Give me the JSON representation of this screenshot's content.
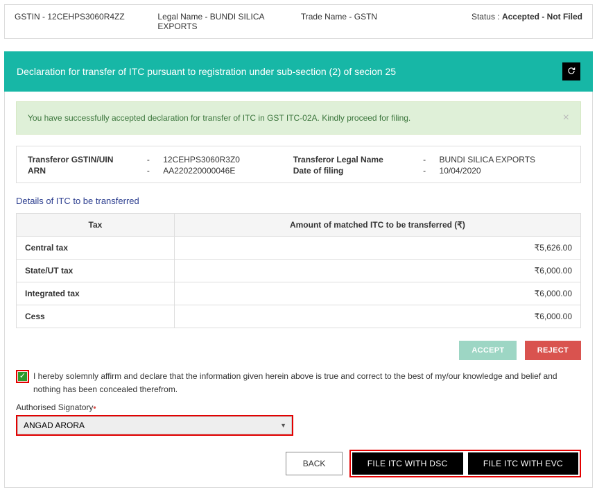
{
  "infoBar": {
    "gstin_label": "GSTIN - ",
    "gstin": "12CEHPS3060R4ZZ",
    "legalName_label": "Legal Name - ",
    "legalName": "BUNDI SILICA EXPORTS",
    "tradeName_label": "Trade Name - ",
    "tradeName": "GSTN",
    "status_label": "Status : ",
    "status_value": "Accepted - Not Filed"
  },
  "header": {
    "title": "Declaration for transfer of ITC pursuant to registration under sub-section (2) of secion 25"
  },
  "alert": {
    "message": "You have successfully accepted declaration for transfer of ITC in GST ITC-02A. Kindly proceed for filing."
  },
  "transferor": {
    "gstinLabel": "Transferor GSTIN/UIN",
    "gstinValue": "12CEHPS3060R3Z0",
    "arnLabel": "ARN",
    "arnValue": "AA220220000046E",
    "legalNameLabel": "Transferor Legal Name",
    "legalNameValue": "BUNDI SILICA EXPORTS",
    "dateLabel": "Date of filing",
    "dateValue": "10/04/2020"
  },
  "sectionTitle": "Details of ITC to be transferred",
  "table": {
    "colTax": "Tax",
    "colAmount": "Amount of matched ITC to be transferred (₹)",
    "rows": {
      "r1": {
        "label": "Central tax",
        "value": "₹5,626.00"
      },
      "r2": {
        "label": "State/UT tax",
        "value": "₹6,000.00"
      },
      "r3": {
        "label": "Integrated tax",
        "value": "₹6,000.00"
      },
      "r4": {
        "label": "Cess",
        "value": "₹6,000.00"
      }
    }
  },
  "buttons": {
    "accept": "ACCEPT",
    "reject": "REJECT",
    "back": "BACK",
    "fileDsc": "FILE ITC WITH DSC",
    "fileEvc": "FILE ITC WITH EVC"
  },
  "declarationText": "I hereby solemnly affirm and declare that the information given herein above is true and correct to the best of my/our knowledge and belief and nothing has been concealed therefrom.",
  "signatory": {
    "label": "Authorised Signatory",
    "value": "ANGAD ARORA"
  }
}
